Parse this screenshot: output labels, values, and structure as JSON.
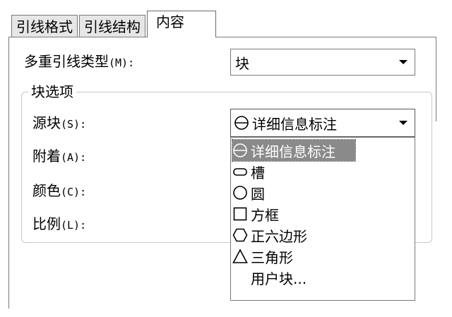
{
  "tabs": [
    {
      "label": "引线格式"
    },
    {
      "label": "引线结构"
    },
    {
      "label": "内容"
    }
  ],
  "multileader_type": {
    "label_cn": "多重引线类型",
    "label_en": "(M):",
    "value": "块"
  },
  "block_options": {
    "group_title": "块选项",
    "source_block": {
      "label_cn": "源块",
      "label_en": "(S):",
      "value": "详细信息标注",
      "icon": "circle-with-line-icon"
    },
    "attachment": {
      "label_cn": "附着",
      "label_en": "(A):"
    },
    "color": {
      "label_cn": "颜色",
      "label_en": "(C):"
    },
    "scale": {
      "label_cn": "比例",
      "label_en": "(L):"
    }
  },
  "dropdown": {
    "items": [
      {
        "label": "详细信息标注",
        "icon": "circle-with-line-icon",
        "selected": true
      },
      {
        "label": "槽",
        "icon": "slot-icon"
      },
      {
        "label": "圆",
        "icon": "circle-icon"
      },
      {
        "label": "方框",
        "icon": "box-icon"
      },
      {
        "label": "正六边形",
        "icon": "hexagon-icon"
      },
      {
        "label": "三角形",
        "icon": "triangle-icon"
      },
      {
        "label": "用户块...",
        "icon": ""
      }
    ]
  }
}
